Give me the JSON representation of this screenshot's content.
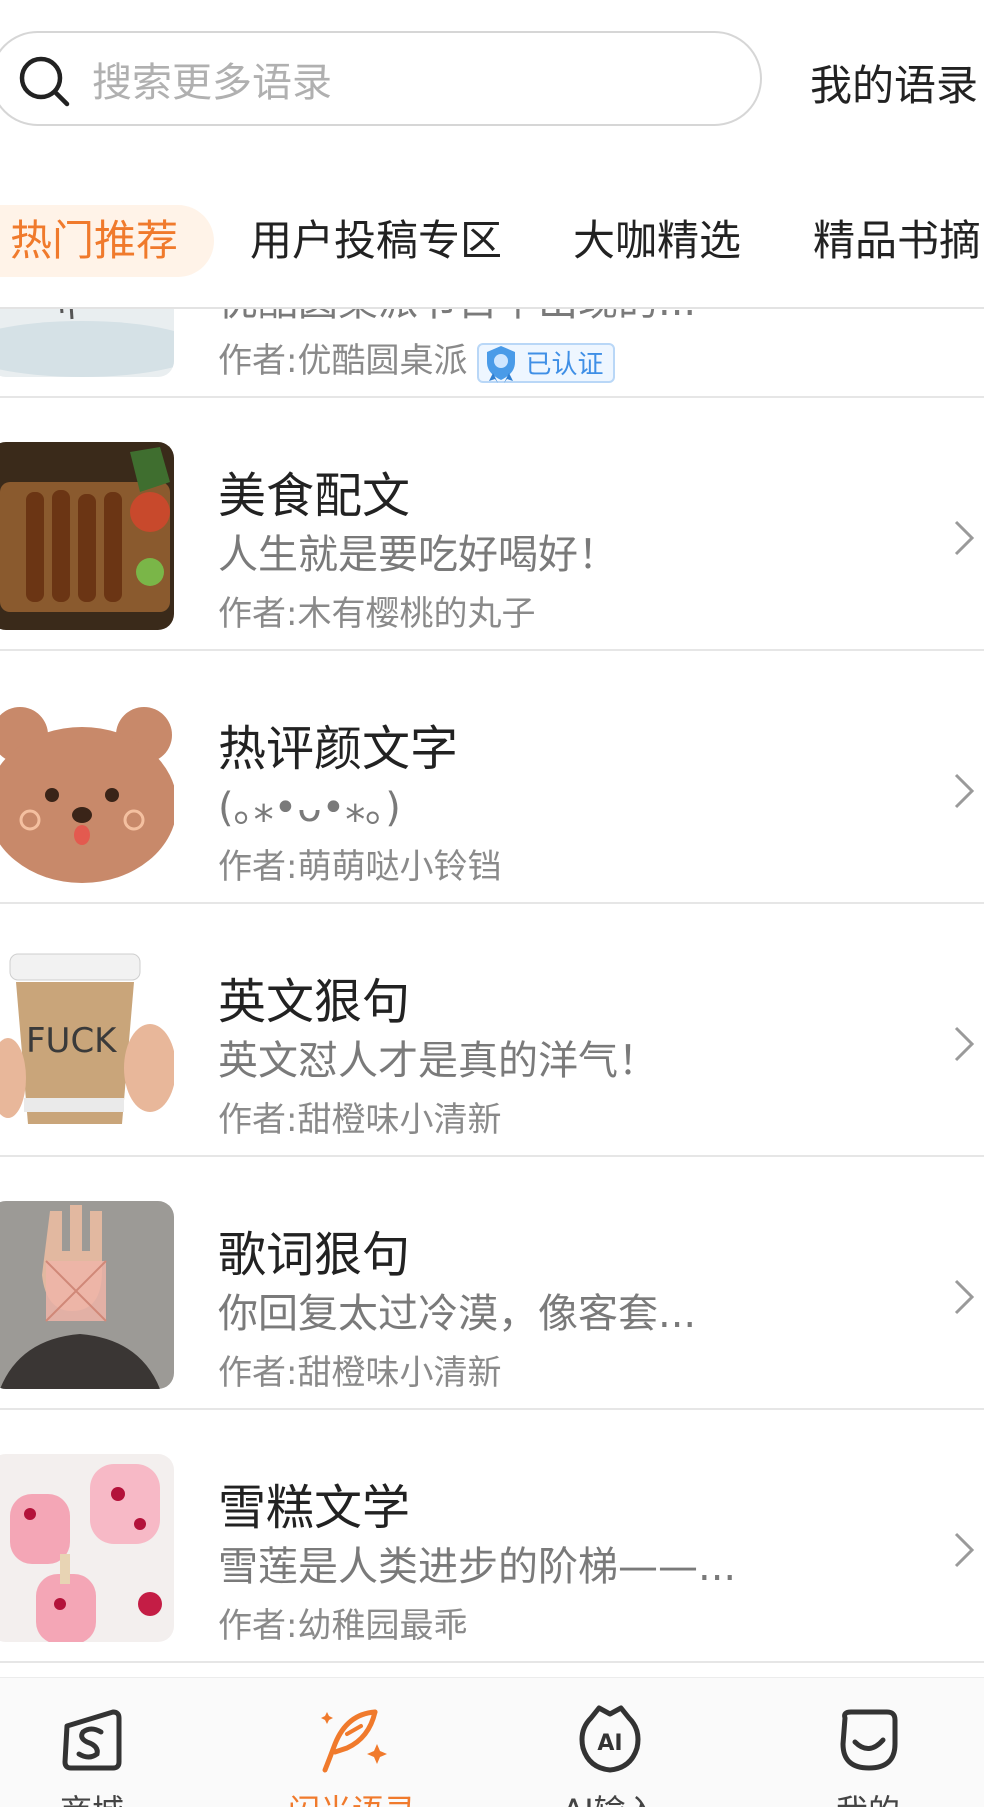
{
  "search": {
    "placeholder": "搜索更多语录"
  },
  "header": {
    "my_quotes": "我的语录"
  },
  "tabs": [
    {
      "label": "热门推荐",
      "active": true
    },
    {
      "label": "用户投稿专区",
      "active": false
    },
    {
      "label": "大咖精选",
      "active": false
    },
    {
      "label": "精品书摘",
      "active": false
    }
  ],
  "items": [
    {
      "title": "",
      "desc": "优酷圆桌派节目中出现的...",
      "author": "作者:优酷圆桌派",
      "badge": "已认证",
      "thumb": "ink-painting-thumbnail"
    },
    {
      "title": "美食配文",
      "desc": "人生就是要吃好喝好！",
      "author": "作者:木有樱桃的丸子",
      "thumb": "food-skewers-thumbnail"
    },
    {
      "title": "热评颜文字",
      "desc": "(｡⁎•ᴗ•⁎｡)",
      "author": "作者:萌萌哒小铃铛",
      "thumb": "bear-face-thumbnail"
    },
    {
      "title": "英文狠句",
      "desc": "英文怼人才是真的洋气！",
      "author": "作者:甜橙味小清新",
      "thumb": "coffee-cup-thumbnail"
    },
    {
      "title": "歌词狠句",
      "desc": "你回复太过冷漠，像客套...",
      "author": "作者:甜橙味小清新",
      "thumb": "hand-portrait-thumbnail"
    },
    {
      "title": "雪糕文学",
      "desc": "雪莲是人类进步的阶梯——...",
      "author": "作者:幼稚园最乖",
      "thumb": "popsicle-thumbnail"
    }
  ],
  "nav": [
    {
      "label": "商城",
      "icon": "shop-icon",
      "active": false
    },
    {
      "label": "闪光语录",
      "icon": "quill-icon",
      "active": true
    },
    {
      "label": "AI输入",
      "icon": "ai-icon",
      "active": false
    },
    {
      "label": "我的",
      "icon": "smile-icon",
      "active": false
    }
  ],
  "colors": {
    "accent": "#f07a2c",
    "verified": "#3f8fe6"
  }
}
